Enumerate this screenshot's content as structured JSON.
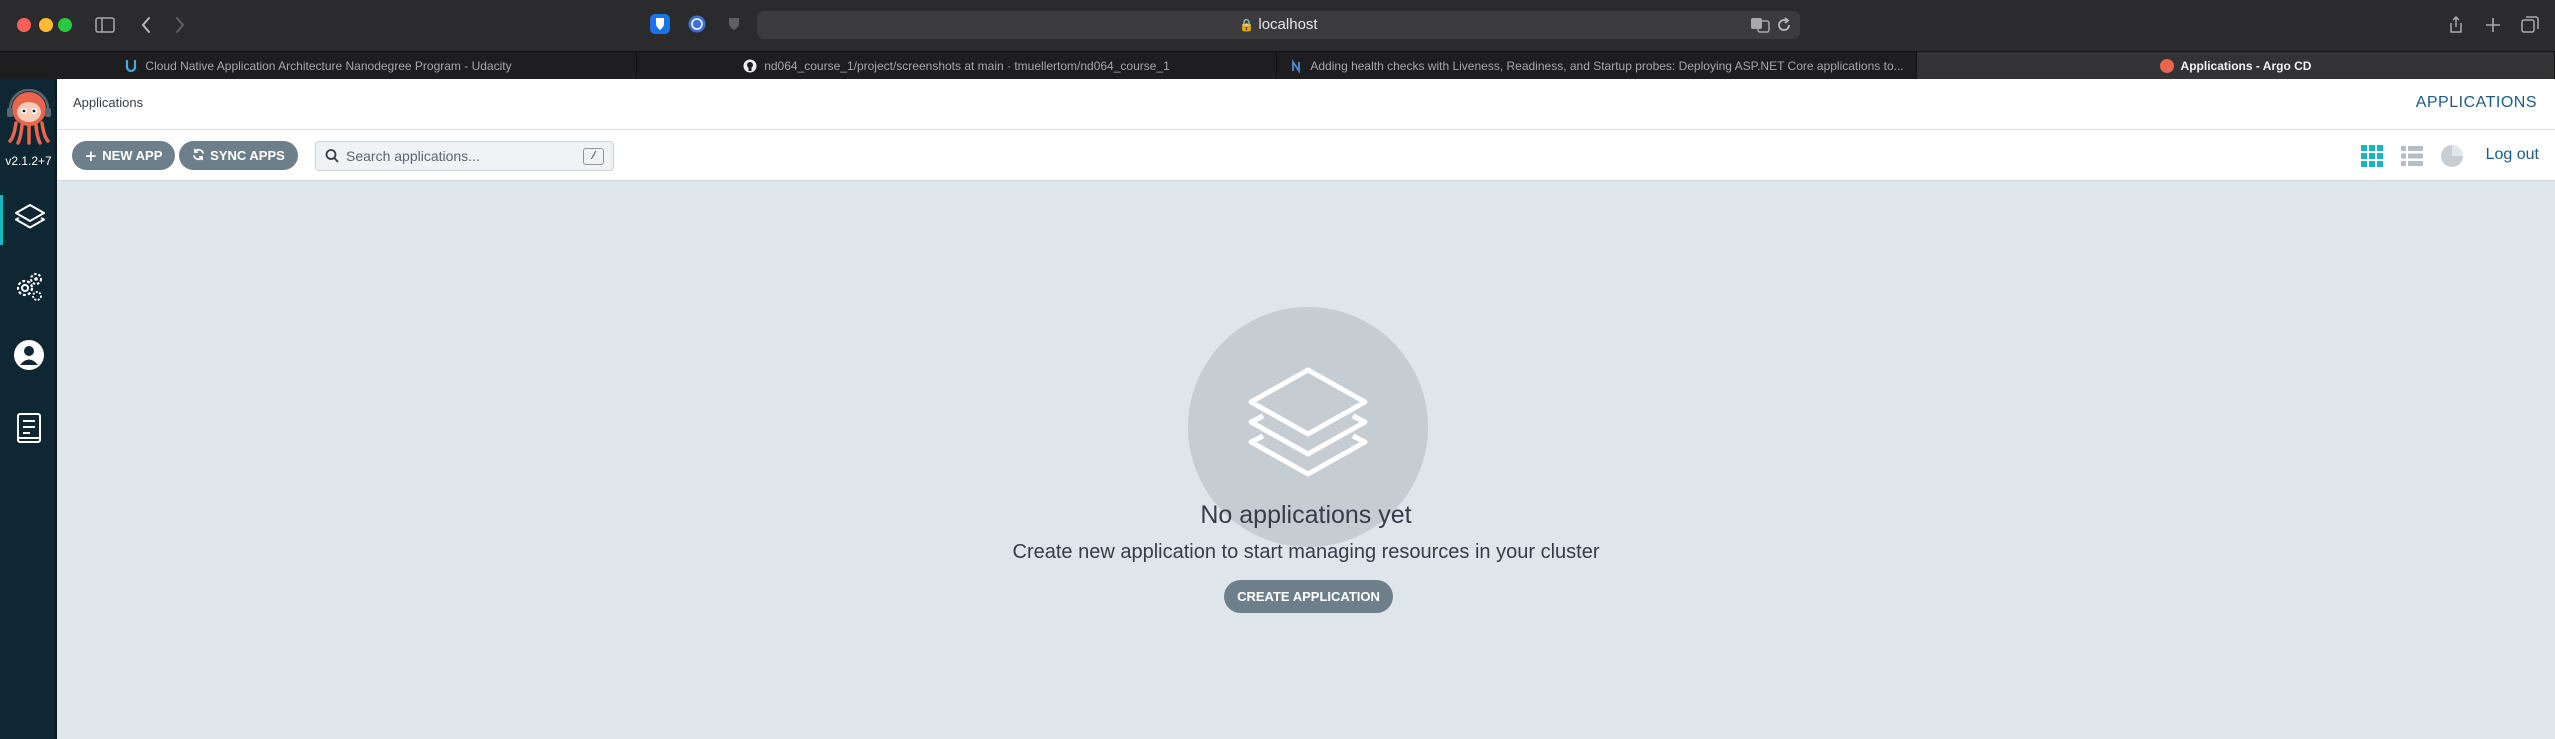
{
  "browser": {
    "url": "localhost",
    "tabs": [
      {
        "title": "Cloud Native Application Architecture Nanodegree Program - Udacity",
        "icon": "udacity-icon"
      },
      {
        "title": "nd064_course_1/project/screenshots at main · tmuellertom/nd064_course_1",
        "icon": "github-icon"
      },
      {
        "title": "Adding health checks with Liveness, Readiness, and Startup probes: Deploying ASP.NET Core applications to...",
        "icon": "blog-icon"
      },
      {
        "title": "Applications - Argo CD",
        "icon": "argo-icon",
        "active": true
      }
    ]
  },
  "sidebar": {
    "version": "v2.1.2+7",
    "items": [
      {
        "name": "applications",
        "icon": "layers-icon",
        "active": true
      },
      {
        "name": "settings",
        "icon": "gears-icon"
      },
      {
        "name": "user-info",
        "icon": "user-icon"
      },
      {
        "name": "documentation",
        "icon": "docs-icon"
      }
    ]
  },
  "header": {
    "breadcrumb": "Applications",
    "title": "APPLICATIONS"
  },
  "toolbar": {
    "new_app_label": "NEW APP",
    "sync_apps_label": "SYNC APPS",
    "search_placeholder": "Search applications...",
    "search_value": "",
    "search_shortcut": "/",
    "logout_label": "Log out",
    "views": [
      "tiles-view-icon",
      "list-view-icon",
      "summary-view-icon"
    ]
  },
  "empty_state": {
    "title": "No applications yet",
    "subtitle": "Create new application to start managing resources in your cluster",
    "button_label": "CREATE APPLICATION"
  },
  "colors": {
    "accent": "#17b6c2",
    "link": "#1b5c87",
    "button": "#6d7f8b",
    "background": "#dee6eb",
    "sidebar": "#0f2733"
  }
}
